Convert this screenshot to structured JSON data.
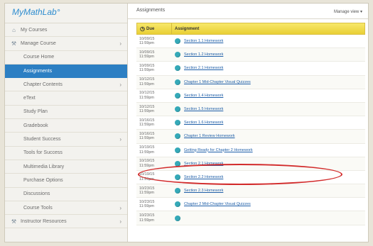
{
  "app": {
    "logo_text": "MyMathLab°"
  },
  "sidebar": {
    "items": [
      {
        "label": "My Courses",
        "level": "top",
        "icon": "home-icon",
        "expandable": false,
        "active": false
      },
      {
        "label": "Manage Course",
        "level": "top",
        "icon": "tools-icon",
        "expandable": true,
        "active": false
      },
      {
        "label": "Course Home",
        "level": "sub",
        "expandable": false,
        "active": false
      },
      {
        "label": "Assignments",
        "level": "sub",
        "expandable": false,
        "active": true
      },
      {
        "label": "Chapter Contents",
        "level": "sub",
        "expandable": true,
        "active": false
      },
      {
        "label": "eText",
        "level": "sub",
        "expandable": false,
        "active": false
      },
      {
        "label": "Study Plan",
        "level": "sub",
        "expandable": false,
        "active": false
      },
      {
        "label": "Gradebook",
        "level": "sub",
        "expandable": false,
        "active": false
      },
      {
        "label": "Student Success",
        "level": "sub",
        "expandable": true,
        "active": false
      },
      {
        "label": "Tools for Success",
        "level": "sub",
        "expandable": false,
        "active": false
      },
      {
        "label": "Multimedia Library",
        "level": "sub",
        "expandable": false,
        "active": false
      },
      {
        "label": "Purchase Options",
        "level": "sub",
        "expandable": false,
        "active": false
      },
      {
        "label": "Discussions",
        "level": "sub",
        "expandable": false,
        "active": false
      },
      {
        "label": "Course Tools",
        "level": "sub",
        "expandable": true,
        "active": false
      },
      {
        "label": "Instructor Resources",
        "level": "top",
        "icon": "tools-icon",
        "expandable": true,
        "active": false
      }
    ]
  },
  "main": {
    "title": "Assignments",
    "manage_view": "Manage view ▾",
    "columns": {
      "due": "Due",
      "assignment": "Assignment"
    },
    "rows": [
      {
        "date": "10/09/15",
        "time": "11:59pm",
        "name": "Section 1.1 Homework",
        "highlighted": false
      },
      {
        "date": "10/09/15",
        "time": "11:59pm",
        "name": "Section 1.2 Homework",
        "highlighted": false
      },
      {
        "date": "10/09/15",
        "time": "11:59pm",
        "name": "Section 2.1 Homework",
        "highlighted": false
      },
      {
        "date": "10/12/15",
        "time": "11:59pm",
        "name": "Chapter 1 Mid-Chapter Visual Quizzes",
        "highlighted": false
      },
      {
        "date": "10/12/15",
        "time": "11:59pm",
        "name": "Section 1.4 Homework",
        "highlighted": false
      },
      {
        "date": "10/12/15",
        "time": "11:59pm",
        "name": "Section 1.5 Homework",
        "highlighted": false
      },
      {
        "date": "10/16/15",
        "time": "11:59pm",
        "name": "Section 1.6 Homework",
        "highlighted": false
      },
      {
        "date": "10/16/15",
        "time": "11:59pm",
        "name": "Chapter 1 Review Homework",
        "highlighted": false
      },
      {
        "date": "10/19/15",
        "time": "11:59pm",
        "name": "Getting Ready for Chapter 2 Homework",
        "highlighted": true
      },
      {
        "date": "10/19/15",
        "time": "11:59pm",
        "name": "Section 2.1 Homework",
        "highlighted": false
      },
      {
        "date": "10/19/15",
        "time": "11:59pm",
        "name": "Section 2.2 Homework",
        "highlighted": false
      },
      {
        "date": "10/23/15",
        "time": "11:59pm",
        "name": "Section 2.3 Homework",
        "highlighted": false
      },
      {
        "date": "10/23/15",
        "time": "11:59pm",
        "name": "Chapter 2 Mid-Chapter Visual Quizzes",
        "highlighted": false
      },
      {
        "date": "10/23/15",
        "time": "11:59pm",
        "name": "",
        "highlighted": false
      }
    ]
  },
  "colors": {
    "accent": "#2c7fc3",
    "header_yellow": "#e9cf35",
    "status_icon": "#35a9b8",
    "link": "#1f5fa8",
    "highlight_oval": "#d22b2b"
  }
}
